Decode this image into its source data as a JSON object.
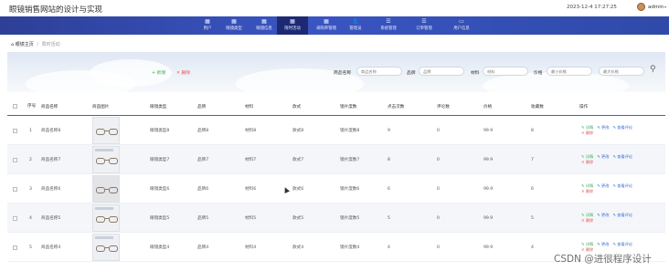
{
  "header": {
    "app_title": "眼镜销售网站的设计与实现",
    "datetime": "2023-12-4 17:27:25",
    "user": "admin",
    "caret": "▾"
  },
  "nav": [
    {
      "label": "用户",
      "icon": "▦"
    },
    {
      "label": "眼镜类型",
      "icon": "▦"
    },
    {
      "label": "眼镜信息",
      "icon": "▦"
    },
    {
      "label": "限时活动",
      "icon": "▦"
    },
    {
      "label": "采购单管理",
      "icon": "▦"
    },
    {
      "label": "管理员",
      "icon": "👤"
    },
    {
      "label": "系统管理",
      "icon": "☰"
    },
    {
      "label": "订单管理",
      "icon": "☰"
    },
    {
      "label": "用户信息",
      "icon": "▭"
    }
  ],
  "breadcrumb": {
    "home": "眼镜主页",
    "separator": "/",
    "current": "限时活动"
  },
  "toolbar": {
    "add": "+ 新增",
    "delete": "✕ 删除"
  },
  "filters": [
    {
      "label": "商品名称",
      "placeholder": "商品名称"
    },
    {
      "label": "品牌",
      "placeholder": "品牌"
    },
    {
      "label": "材料",
      "placeholder": "材料"
    },
    {
      "label": "价格",
      "placeholder": "最小价格"
    },
    {
      "label": "",
      "placeholder": "最大价格"
    }
  ],
  "table": {
    "columns": [
      "序号",
      "商品名称",
      "商品图片",
      "眼镜类型",
      "品牌",
      "材料",
      "款式",
      "镜片度数",
      "点击次数",
      "评论数",
      "价格",
      "收藏数",
      "操作"
    ],
    "rows": [
      {
        "index": "1",
        "name": "商品名称8",
        "type": "眼镜类型8",
        "brand": "品牌8",
        "material": "材料8",
        "style": "款式8",
        "lens": "镜片度数8",
        "clicks": "9",
        "comments": "0",
        "price": "99.9",
        "favorites": "8"
      },
      {
        "index": "2",
        "name": "商品名称7",
        "type": "眼镜类型7",
        "brand": "品牌7",
        "material": "材料7",
        "style": "款式7",
        "lens": "镜片度数7",
        "clicks": "8",
        "comments": "0",
        "price": "99.9",
        "favorites": "7"
      },
      {
        "index": "3",
        "name": "商品名称6",
        "type": "眼镜类型6",
        "brand": "品牌6",
        "material": "材料6",
        "style": "款式6",
        "lens": "镜片度数6",
        "clicks": "6",
        "comments": "0",
        "price": "99.9",
        "favorites": "6"
      },
      {
        "index": "4",
        "name": "商品名称5",
        "type": "眼镜类型5",
        "brand": "品牌5",
        "material": "材料5",
        "style": "款式5",
        "lens": "镜片度数5",
        "clicks": "5",
        "comments": "0",
        "price": "99.9",
        "favorites": "5"
      },
      {
        "index": "5",
        "name": "商品名称4",
        "type": "眼镜类型4",
        "brand": "品牌4",
        "material": "材料4",
        "style": "款式4",
        "lens": "镜片度数4",
        "clicks": "4",
        "comments": "0",
        "price": "99.9",
        "favorites": "4"
      }
    ],
    "actions": {
      "detail": "✎ 详情",
      "edit": "✎ 更改",
      "review": "✎ 查看评论",
      "delete": "✕ 删除"
    }
  },
  "watermark": "CSDN @进很程序设计",
  "colors": {
    "nav": "#3a55c2",
    "nav_active": "#1d2a73",
    "accent": "#3a5fc8",
    "add": "#3fae5a",
    "delete": "#e05a5a"
  }
}
